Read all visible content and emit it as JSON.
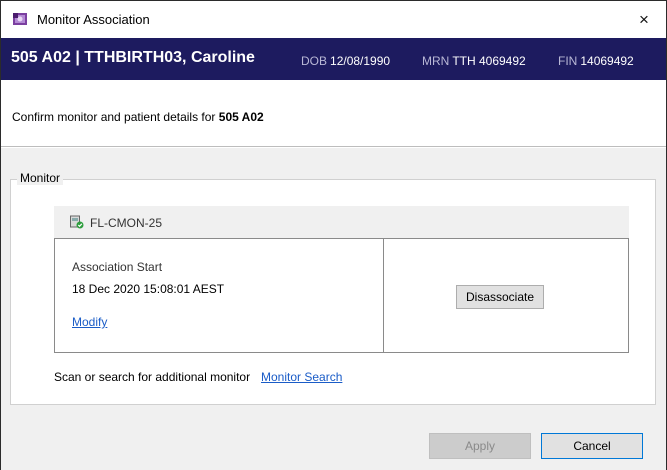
{
  "window": {
    "title": "Monitor Association",
    "close_glyph": "×",
    "icon": "app-icon"
  },
  "patient": {
    "name": "505 A02 | TTHBIRTH03, Caroline",
    "dob_label": "DOB",
    "dob_value": "12/08/1990",
    "mrn_label": "MRN",
    "mrn_value": "TTH 4069492",
    "fin_label": "FIN",
    "fin_value": "14069492",
    "banner_color": "#1d1b5f"
  },
  "confirm": {
    "prefix": "Confirm monitor and patient details for ",
    "bed": "505 A02"
  },
  "monitor_group": {
    "legend": "Monitor",
    "device": {
      "icon": "monitor-device-icon",
      "name": "FL-CMON-25"
    },
    "association": {
      "label": "Association Start",
      "value": "18 Dec 2020 15:08:01 AEST",
      "modify_label": "Modify",
      "disassociate_label": "Disassociate"
    },
    "scan_text": "Scan or search for additional monitor",
    "search_link": "Monitor Search"
  },
  "footer": {
    "apply_label": "Apply",
    "cancel_label": "Cancel"
  },
  "colors": {
    "link": "#1a5cc7",
    "panel_bg": "#f0f0f0",
    "focus_border": "#0078d7"
  }
}
